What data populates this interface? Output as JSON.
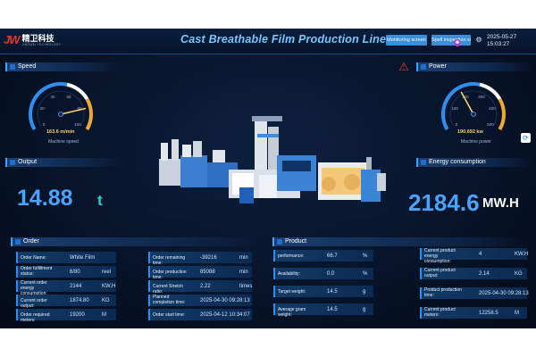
{
  "header": {
    "logo_mark": "JW",
    "logo_cn": "精卫科技",
    "logo_en": "JINGWEI TECHNOLOGY",
    "title": "Cast Breathable Film Production Line MES",
    "btn_monitoring": "Monitoring screen",
    "btn_spec": "Spell inspection screen",
    "date": "2025-05-27",
    "time": "15:03:27"
  },
  "speed": {
    "title": "Speed",
    "value": "163.6 m/min",
    "caption": "Machine speed",
    "ticks": [
      "0",
      "20",
      "40",
      "60",
      "80",
      "100"
    ],
    "fraction": 0.82
  },
  "power": {
    "title": "Power",
    "value": "190.692 kw",
    "caption": "Machine power",
    "ticks": [
      "0",
      "100",
      "200",
      "300",
      "400",
      "500"
    ],
    "fraction": 0.38
  },
  "output": {
    "title": "Output",
    "value": "14.88",
    "unit": "t"
  },
  "energy": {
    "title": "Energy consumption",
    "value": "2184.6",
    "unit": "MW.H"
  },
  "order": {
    "title": "Order",
    "left": [
      {
        "label": "Order Name:",
        "value": "White Film",
        "unit": ""
      },
      {
        "label": "Order fulfillment status:",
        "value": "6/80",
        "unit": "reel"
      },
      {
        "label": "Current order energy consumption:",
        "value": "2144",
        "unit": "KW.H"
      },
      {
        "label": "Current order output:",
        "value": "1874.80",
        "unit": "KG"
      },
      {
        "label": "Order required meters:",
        "value": "19200",
        "unit": "M"
      }
    ],
    "right": [
      {
        "label": "Order remaining time:",
        "value": "-39216",
        "unit": "min"
      },
      {
        "label": "Order production time:",
        "value": "85088",
        "unit": "min"
      },
      {
        "label": "Current Stretch ratio:",
        "value": "2.22",
        "unit": "times"
      },
      {
        "label": "Planned completion time:",
        "value": "2025-04-30 09:28:13",
        "unit": ""
      },
      {
        "label": "Order start time:",
        "value": "2025-04-12 10:34:07",
        "unit": ""
      }
    ]
  },
  "product": {
    "title": "Product",
    "left": [
      {
        "label": "performance:",
        "value": "66.7",
        "unit": "%"
      },
      {
        "label": "Availability:",
        "value": "0.0",
        "unit": "%"
      },
      {
        "label": "Target weight:",
        "value": "14.5",
        "unit": "g"
      },
      {
        "label": "Average gram weight:",
        "value": "14.5",
        "unit": "g"
      }
    ],
    "right": [
      {
        "label": "Current product energy consumption:",
        "value": "4",
        "unit": "KW.H"
      },
      {
        "label": "Current product output:",
        "value": "2.14",
        "unit": "KG"
      },
      {
        "label": "Product production time:",
        "value": "2025-04-30 09:28:13",
        "unit": ""
      },
      {
        "label": "Current product meters:",
        "value": "12258.5",
        "unit": "M"
      }
    ]
  },
  "colors": {
    "accent": "#3da3ff",
    "value_blue": "#4aa3ff",
    "teal": "#22d4d0",
    "alarm": "#e03a2f"
  }
}
